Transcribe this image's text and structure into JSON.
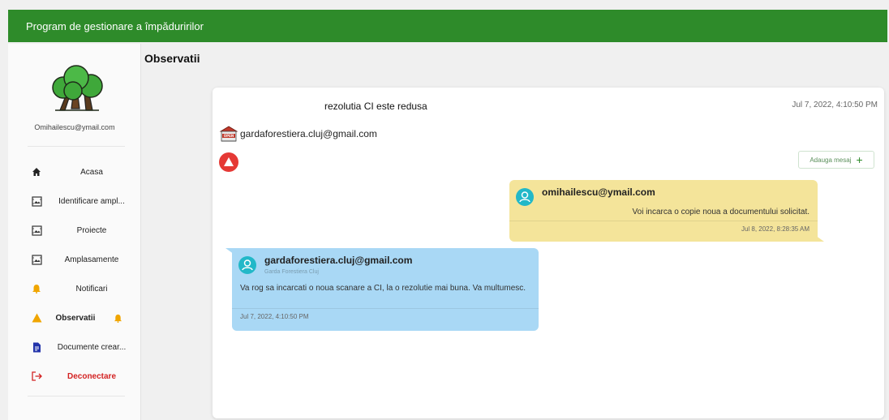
{
  "app": {
    "title": "Program de gestionare a împăduririlor"
  },
  "sidebar": {
    "user_email": "Omihailescu@ymail.com",
    "items": [
      {
        "label": "Acasa",
        "icon": "home-icon"
      },
      {
        "label": "Identificare ampl...",
        "icon": "image-frame-icon"
      },
      {
        "label": "Proiecte",
        "icon": "image-frame-icon"
      },
      {
        "label": "Amplasamente",
        "icon": "image-frame-icon"
      },
      {
        "label": "Notificari",
        "icon": "bell-icon"
      },
      {
        "label": "Observatii",
        "icon": "warning-icon"
      },
      {
        "label": "Documente crear...",
        "icon": "document-icon"
      },
      {
        "label": "Deconectare",
        "icon": "logout-icon"
      }
    ]
  },
  "page": {
    "title": "Observatii"
  },
  "observation": {
    "title": "rezolutia CI este redusa",
    "date": "Jul 7, 2022, 4:10:50 PM",
    "sender": "gardaforestiera.cluj@gmail.com",
    "add_message_label": "Adauga mesaj"
  },
  "messages": [
    {
      "author": "omihailescu@ymail.com",
      "text": "Voi incarca o copie noua a documentului solicitat.",
      "time": "Jul 8, 2022, 8:28:35 AM"
    },
    {
      "author": "gardaforestiera.cluj@gmail.com",
      "subtitle": "Garda Forestiera Cluj",
      "text": "Va rog sa incarcati o noua scanare a CI, la o rezolutie mai buna. Va multumesc.",
      "time": "Jul 7, 2022, 4:10:50 PM"
    }
  ],
  "colors": {
    "appbar": "#2e8b2a",
    "accent_alert": "#e53935",
    "bubble_own": "#f4e49a",
    "bubble_other": "#a9d8f5",
    "logout": "#d32222",
    "avatar": "#22b8c8"
  }
}
